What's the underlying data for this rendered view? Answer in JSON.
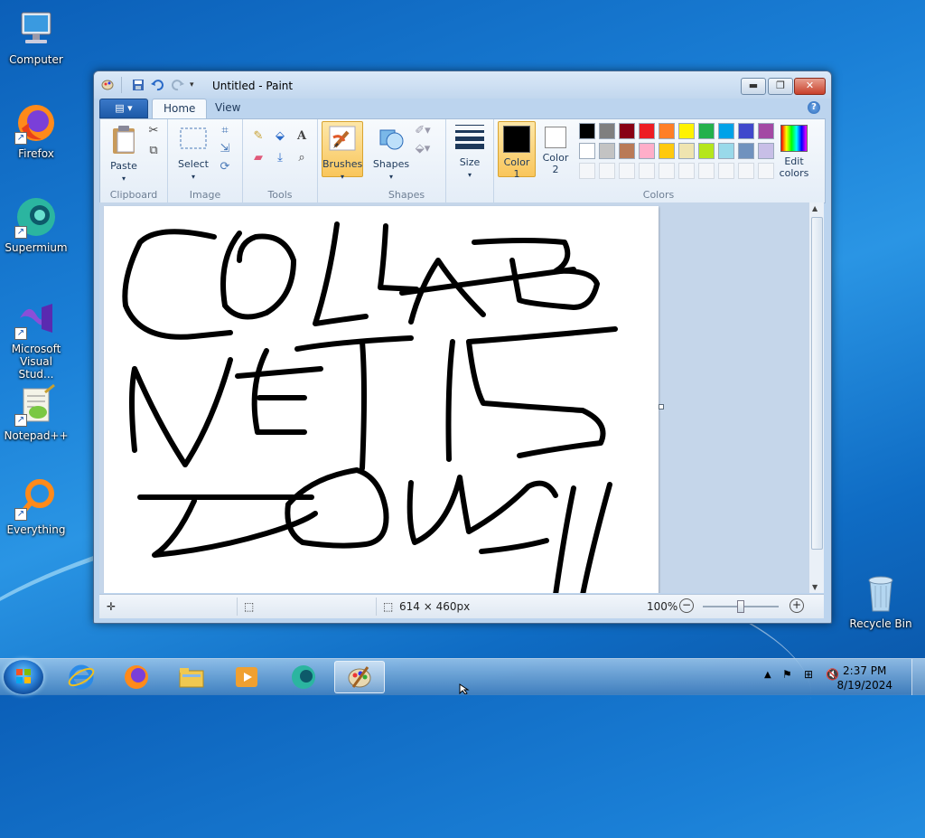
{
  "desktop": {
    "icons": [
      {
        "label": "Computer"
      },
      {
        "label": "Firefox"
      },
      {
        "label": "Supermium"
      },
      {
        "label": "Microsoft Visual Stud..."
      },
      {
        "label": "Notepad++"
      },
      {
        "label": "Everything"
      },
      {
        "label": "Recycle Bin"
      }
    ]
  },
  "window": {
    "title": "Untitled - Paint",
    "tabs": [
      {
        "label": "Home"
      },
      {
        "label": "View"
      }
    ],
    "help": "?"
  },
  "ribbon": {
    "groups": {
      "clipboard": "Clipboard",
      "image": "Image",
      "tools": "Tools",
      "shapes": "Shapes",
      "colors": "Colors"
    },
    "buttons": {
      "paste": "Paste",
      "select": "Select",
      "brushes": "Brushes",
      "shapes": "Shapes",
      "size": "Size",
      "color1": "Color\n1",
      "color2": "Color\n2",
      "edit_colors": "Edit\ncolors"
    },
    "color1_value": "#000000",
    "color2_value": "#ffffff",
    "palette_row1": [
      "#000000",
      "#7f7f7f",
      "#880015",
      "#ed1c24",
      "#ff7f27",
      "#fff200",
      "#22b14c",
      "#00a2e8",
      "#3f48cc",
      "#a349a4"
    ],
    "palette_row2": [
      "#ffffff",
      "#c3c3c3",
      "#b97a57",
      "#ffaec9",
      "#ffc90e",
      "#efe4b0",
      "#b5e61d",
      "#99d9ea",
      "#7092be",
      "#c8bfe7"
    ]
  },
  "canvas": {
    "drawing_text": "COLLAB NET IS DOWN"
  },
  "statusbar": {
    "dimensions": "614 × 460px",
    "zoom": "100%"
  },
  "taskbar": {
    "time": "2:37 PM",
    "date": "8/19/2024"
  }
}
